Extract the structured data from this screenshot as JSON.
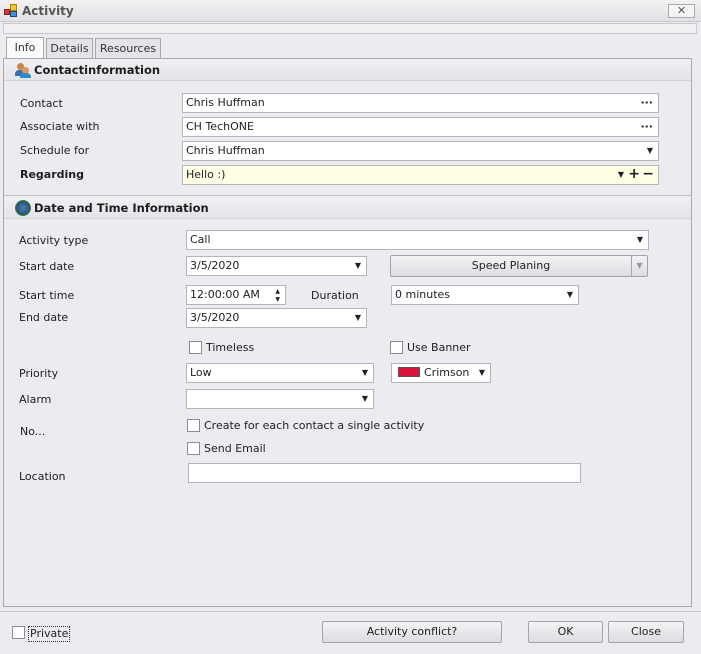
{
  "window": {
    "title": "Activity",
    "close": "✕"
  },
  "tabs": [
    {
      "label": "Info"
    },
    {
      "label": "Details"
    },
    {
      "label": "Resources"
    }
  ],
  "contact_section": {
    "title": "Contactinformation",
    "contact": {
      "label": "Contact",
      "value": "Chris Huffman"
    },
    "associate": {
      "label": "Associate with",
      "value": "CH TechONE"
    },
    "schedule": {
      "label": "Schedule for",
      "value": "Chris Huffman"
    },
    "regarding": {
      "label": "Regarding",
      "value": "Hello :)"
    }
  },
  "date_section": {
    "title": "Date and Time Information",
    "activity_type": {
      "label": "Activity type",
      "value": "Call"
    },
    "start_date": {
      "label": "Start date",
      "value": "3/5/2020"
    },
    "speed_planing": "Speed Planing",
    "start_time": {
      "label": "Start time",
      "value": "12:00:00 AM"
    },
    "duration": {
      "label": "Duration",
      "value": "0 minutes"
    },
    "end_date": {
      "label": "End date",
      "value": "3/5/2020"
    },
    "timeless": {
      "label": "Timeless",
      "checked": false
    },
    "use_banner": {
      "label": "Use Banner",
      "checked": false
    },
    "priority": {
      "label": "Priority",
      "value": "Low"
    },
    "color": {
      "value": "Crimson",
      "swatch": "#dc143c"
    },
    "alarm": {
      "label": "Alarm",
      "value": ""
    },
    "no_label": "No...",
    "single_activity": {
      "label": "Create for each contact a single activity",
      "checked": false
    },
    "send_email": {
      "label": "Send Email",
      "checked": false
    },
    "location": {
      "label": "Location",
      "value": ""
    }
  },
  "footer": {
    "private": "Private",
    "conflict": "Activity conflict?",
    "ok": "OK",
    "close": "Close"
  }
}
